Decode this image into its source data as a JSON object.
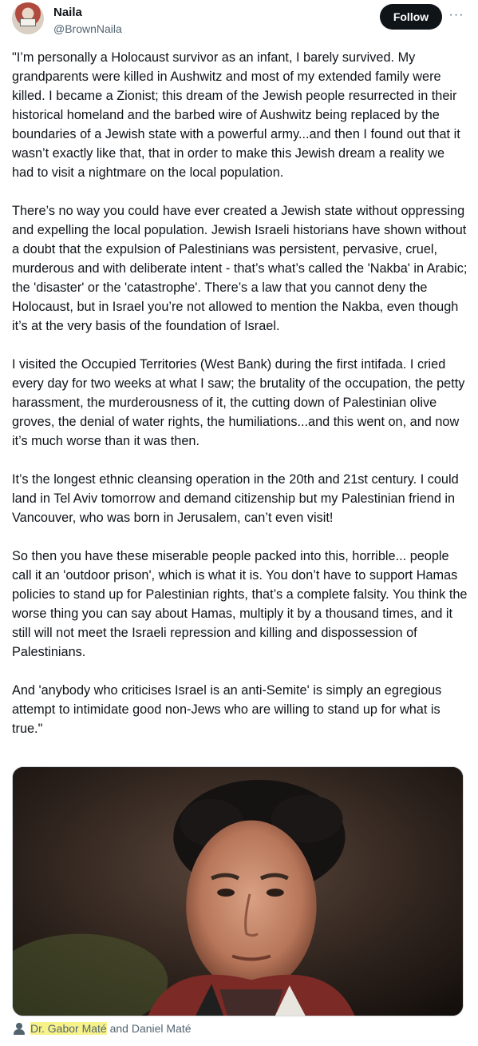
{
  "author": {
    "name": "Naila",
    "handle": "@BrownNaila"
  },
  "actions": {
    "follow_label": "Follow",
    "more_label": "···"
  },
  "tweet": {
    "paragraphs": [
      "\"I’m personally a Holocaust survivor as an infant, I barely survived. My grandparents were killed in Aushwitz and most of my extended family were killed. I became a Zionist; this dream of the Jewish people resurrected in their historical homeland and the barbed wire of Aushwitz being replaced by the boundaries of a Jewish state with a powerful army...and then I found out that it wasn’t exactly like that, that in order to make this Jewish dream a reality we had to visit a nightmare on the local population.",
      "There’s no way you could have ever created a Jewish state without oppressing and expelling the local population. Jewish Israeli historians have shown without a doubt that the expulsion of Palestinians was persistent, pervasive, cruel, murderous and with deliberate intent - that’s what’s called the 'Nakba' in Arabic; the 'disaster' or the 'catastrophe'. There’s a law that you cannot deny the Holocaust, but in Israel you’re not allowed to mention the Nakba, even though it’s at the very basis of the foundation of Israel.",
      "I visited the Occupied Territories (West Bank) during the first intifada. I cried every day for two weeks at what I saw; the brutality of the occupation, the petty harassment, the murderousness of it, the cutting down of Palestinian olive groves, the denial of water rights, the humiliations...and this went on, and now it’s much worse than it was then.",
      "It’s the longest ethnic cleansing operation in the 20th and 21st century. I could land in Tel Aviv tomorrow and demand citizenship but my Palestinian friend in Vancouver, who was born in Jerusalem, can’t even visit!",
      "So then you have these miserable people packed into this, horrible... people call it an 'outdoor prison', which is what it is. You don’t have to support Hamas policies to stand up for Palestinian rights, that’s a complete falsity. You think the worse thing you can say about Hamas, multiply it by a thousand times, and it still will not meet the Israeli repression and killing and dispossession of Palestinians.",
      "And 'anybody who criticises Israel is an anti-Semite' is simply an egregious attempt to intimidate good non-Jews who are willing to stand up for what is true.\""
    ]
  },
  "media": {
    "icon": "photo"
  },
  "caption": {
    "icon": "person-icon",
    "highlighted": "Dr. Gabor Maté",
    "rest": " and Daniel Maté"
  },
  "colors": {
    "text": "#0f1419",
    "secondary": "#536471",
    "highlight": "#f7f38a"
  }
}
